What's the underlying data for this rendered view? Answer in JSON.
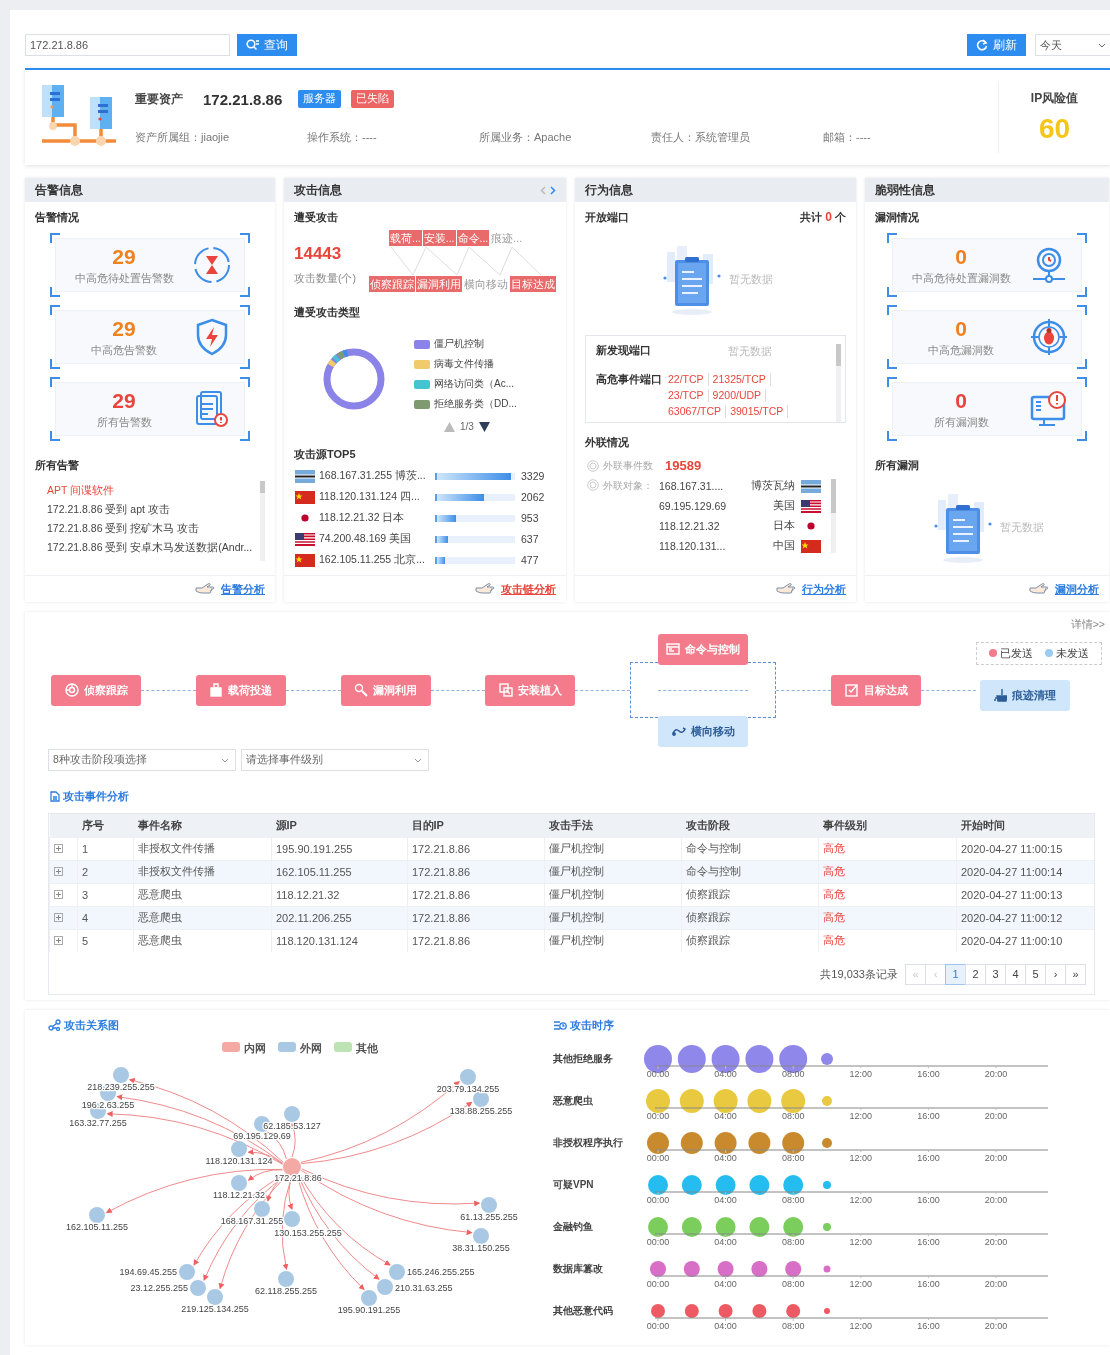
{
  "search": {
    "value": "172.21.8.86",
    "button": "查询"
  },
  "refresh_button": "刷新",
  "range_select": {
    "value": "今天"
  },
  "asset": {
    "title": "重要资产",
    "ip": "172.21.8.86",
    "tags": [
      {
        "label": "服务器",
        "kind": "type"
      },
      {
        "label": "已失陷",
        "kind": "status"
      }
    ],
    "fields": [
      {
        "label": "资产所属组：",
        "value": "jiaojie"
      },
      {
        "label": "操作系统：",
        "value": "----"
      },
      {
        "label": "所属业务：",
        "value": "Apache"
      },
      {
        "label": "责任人：",
        "value": "系统管理员"
      },
      {
        "label": "邮箱：",
        "value": "----"
      }
    ],
    "risk_label": "IP风险值",
    "risk_value": "60"
  },
  "alert_panel": {
    "title": "告警信息",
    "section": "告警情况",
    "stats": [
      {
        "value": "29",
        "label": "中高危待处置告警数",
        "kind": "hourglass",
        "color": "#f0811f"
      },
      {
        "value": "29",
        "label": "中高危告警数",
        "kind": "shield",
        "color": "#f0811f"
      },
      {
        "value": "29",
        "label": "所有告警数",
        "kind": "document",
        "color": "#e8453c"
      }
    ],
    "list_title": "所有告警",
    "alerts": [
      {
        "text": "APT 间谍软件",
        "kind": "heading"
      },
      {
        "text": "172.21.8.86 受到 apt 攻击",
        "kind": "item"
      },
      {
        "text": "172.21.8.86 受到 挖矿木马 攻击",
        "kind": "item"
      },
      {
        "text": "172.21.8.86 受到 安卓木马发送数据(Andr...",
        "kind": "item"
      }
    ],
    "link": "告警分析"
  },
  "attack_panel": {
    "title": "攻击信息",
    "section": "遭受攻击",
    "count": "14443",
    "count_label": "攻击数量(个)",
    "stages_top": [
      {
        "label": "载荷...",
        "highlighted": true
      },
      {
        "label": "安装...",
        "highlighted": true
      },
      {
        "label": "命令...",
        "highlighted": true
      },
      {
        "label": "痕迹...",
        "highlighted": false
      }
    ],
    "stages_bottom": [
      {
        "label": "侦察跟踪",
        "highlighted": true
      },
      {
        "label": "漏洞利用",
        "highlighted": true
      },
      {
        "label": "横向移动",
        "highlighted": false
      },
      {
        "label": "目标达成",
        "highlighted": true
      }
    ],
    "types_title": "遭受攻击类型",
    "types": [
      {
        "label": "僵尸机控制",
        "color": "#8b83e8"
      },
      {
        "label": "病毒文件传播",
        "color": "#efcb6a"
      },
      {
        "label": "网络访问类（Ac...",
        "color": "#45c3d0"
      },
      {
        "label": "拒绝服务类（DD...",
        "color": "#7f9a6e"
      }
    ],
    "types_pager": "1/3",
    "top_title": "攻击源TOP5",
    "top": [
      {
        "label": "168.167.31.255 博茨...",
        "kind": "botswana",
        "level": 0.95,
        "count": "3329"
      },
      {
        "label": "118.120.131.124 四...",
        "kind": "china",
        "level": 0.6,
        "count": "2062"
      },
      {
        "label": "118.12.21.32 日本",
        "kind": "japan",
        "level": 0.24,
        "count": "953"
      },
      {
        "label": "74.200.48.169 美国",
        "kind": "usa",
        "level": 0.14,
        "count": "637"
      },
      {
        "label": "162.105.11.255 北京...",
        "kind": "china",
        "level": 0.1,
        "count": "477"
      }
    ],
    "link": "攻击链分析"
  },
  "behavior_panel": {
    "title": "行为信息",
    "section": "开放端口",
    "total_prefix": "共计",
    "total": "0",
    "total_suffix": "个",
    "empty_text": "暂无数据",
    "new_ports_label": "新发现端口",
    "new_ports_empty": "暂无数据",
    "risk_ports_label": "高危事件端口",
    "risk_ports": [
      "22/TCP",
      "21325/TCP",
      "23/TCP",
      "9200/UDP",
      "63067/TCP",
      "39015/TCP"
    ],
    "outbound_title": "外联情况",
    "event_label": "外联事件数",
    "event_count": "19589",
    "target_label": "外联对象：",
    "targets": [
      {
        "ip": "168.167.31....",
        "country": "博茨瓦纳",
        "kind": "botswana"
      },
      {
        "ip": "69.195.129.69",
        "country": "美国",
        "kind": "usa"
      },
      {
        "ip": "118.12.21.32",
        "country": "日本",
        "kind": "japan"
      },
      {
        "ip": "118.120.131...",
        "country": "中国",
        "kind": "china"
      }
    ],
    "link": "行为分析"
  },
  "vuln_panel": {
    "title": "脆弱性信息",
    "section": "漏洞情况",
    "stats": [
      {
        "value": "0",
        "label": "中高危待处置漏洞数",
        "kind": "pin",
        "color": "#f0811f"
      },
      {
        "value": "0",
        "label": "中高危漏洞数",
        "kind": "bug",
        "color": "#f0811f"
      },
      {
        "value": "0",
        "label": "所有漏洞数",
        "kind": "monitor",
        "color": "#e8453c"
      }
    ],
    "list_title": "所有漏洞",
    "empty_text": "暂无数据",
    "link": "漏洞分析"
  },
  "kill_chain": {
    "details_link": "详情>>",
    "legend": [
      {
        "label": "已发送",
        "color": "#f37b8b"
      },
      {
        "label": "未发送",
        "color": "#9ccbf2"
      }
    ],
    "steps": [
      {
        "label": "侦察跟踪",
        "kind": "target",
        "sent": true
      },
      {
        "label": "载荷投递",
        "kind": "package",
        "sent": true
      },
      {
        "label": "漏洞利用",
        "kind": "magnifier",
        "sent": true
      },
      {
        "label": "安装植入",
        "kind": "install",
        "sent": true
      },
      {
        "label": "命令与控制",
        "kind": "terminal",
        "sent": true
      },
      {
        "label": "横向移动",
        "kind": "lateral",
        "sent": false
      },
      {
        "label": "目标达成",
        "kind": "check",
        "sent": true
      },
      {
        "label": "痕迹清理",
        "kind": "broom",
        "sent": false
      }
    ]
  },
  "filters": [
    {
      "placeholder": "8种攻击阶段项选择"
    },
    {
      "placeholder": "请选择事件级别"
    }
  ],
  "events": {
    "title": "攻击事件分析",
    "columns": [
      "序号",
      "事件名称",
      "源IP",
      "目的IP",
      "攻击手法",
      "攻击阶段",
      "事件级别",
      "开始时间"
    ],
    "rows": [
      {
        "expanded": false,
        "cells": [
          "1",
          "非授权文件传播",
          "195.90.191.255",
          "172.21.8.86",
          "僵尸机控制",
          "命令与控制",
          "高危",
          "2020-04-27 11:00:15"
        ]
      },
      {
        "expanded": false,
        "cells": [
          "2",
          "非授权文件传播",
          "162.105.11.255",
          "172.21.8.86",
          "僵尸机控制",
          "命令与控制",
          "高危",
          "2020-04-27 11:00:14"
        ]
      },
      {
        "expanded": false,
        "cells": [
          "3",
          "恶意爬虫",
          "118.12.21.32",
          "172.21.8.86",
          "僵尸机控制",
          "侦察跟踪",
          "高危",
          "2020-04-27 11:00:13"
        ]
      },
      {
        "expanded": false,
        "cells": [
          "4",
          "恶意爬虫",
          "202.11.206.255",
          "172.21.8.86",
          "僵尸机控制",
          "侦察跟踪",
          "高危",
          "2020-04-27 11:00:12"
        ]
      },
      {
        "expanded": false,
        "cells": [
          "5",
          "恶意爬虫",
          "118.120.131.124",
          "172.21.8.86",
          "僵尸机控制",
          "侦察跟踪",
          "高危",
          "2020-04-27 11:00:10"
        ]
      }
    ],
    "total": "共19,033条记录",
    "first": {
      "label": "«",
      "disabled": true
    },
    "prev": {
      "label": "‹",
      "disabled": true
    },
    "pages": [
      {
        "label": "1",
        "selected": true
      },
      {
        "label": "2",
        "selected": false
      },
      {
        "label": "3",
        "selected": false
      },
      {
        "label": "4",
        "selected": false
      },
      {
        "label": "5",
        "selected": false
      }
    ],
    "next": {
      "label": "›",
      "disabled": false
    },
    "last": {
      "label": "»",
      "disabled": false
    }
  },
  "graph": {
    "title": "攻击关系图",
    "legend": [
      {
        "label": "内网",
        "color": "#f4a9a5"
      },
      {
        "label": "外网",
        "color": "#a9c8e4"
      },
      {
        "label": "其他",
        "color": "#bde3b4"
      }
    ],
    "nodes": [
      {
        "label": "172.21.8.86",
        "kind": "internal"
      },
      {
        "label": "218.239.255.255",
        "kind": "external"
      },
      {
        "label": "196.2.63.255",
        "kind": "external"
      },
      {
        "label": "163.32.77.255",
        "kind": "external"
      },
      {
        "label": "62.185.53.127",
        "kind": "external"
      },
      {
        "label": "69.195.129.69",
        "kind": "external"
      },
      {
        "label": "118.120.131.124",
        "kind": "external"
      },
      {
        "label": "118.12.21.32",
        "kind": "external"
      },
      {
        "label": "168.167.31.255",
        "kind": "external"
      },
      {
        "label": "130.153.255.255",
        "kind": "external"
      },
      {
        "label": "162.105.11.255",
        "kind": "external"
      },
      {
        "label": "203.79.134.255",
        "kind": "external"
      },
      {
        "label": "138.88.255.255",
        "kind": "external"
      },
      {
        "label": "61.13.255.255",
        "kind": "external"
      },
      {
        "label": "38.31.150.255",
        "kind": "external"
      },
      {
        "label": "194.69.45.255",
        "kind": "external"
      },
      {
        "label": "23.12.255.255",
        "kind": "external"
      },
      {
        "label": "219.125.134.255",
        "kind": "external"
      },
      {
        "label": "62.118.255.255",
        "kind": "external"
      },
      {
        "label": "165.246.255.255",
        "kind": "external"
      },
      {
        "label": "210.31.63.255",
        "kind": "external"
      },
      {
        "label": "195.90.191.255",
        "kind": "external"
      }
    ]
  },
  "timeline": {
    "title": "攻击时序",
    "rows": [
      {
        "label": "其他拒绝服务",
        "color": "#8f87ea",
        "ticks": [
          "00:00",
          "04:00",
          "08:00",
          "12:00",
          "16:00",
          "20:00"
        ]
      },
      {
        "label": "恶意爬虫",
        "color": "#e8c940",
        "ticks": [
          "00:00",
          "04:00",
          "08:00",
          "12:00",
          "16:00",
          "20:00"
        ]
      },
      {
        "label": "非授权程序执行",
        "color": "#c98a2e",
        "ticks": [
          "00:00",
          "04:00",
          "08:00",
          "12:00",
          "16:00",
          "20:00"
        ]
      },
      {
        "label": "可疑VPN",
        "color": "#25bdf0",
        "ticks": [
          "00:00",
          "04:00",
          "08:00",
          "12:00",
          "16:00",
          "20:00"
        ]
      },
      {
        "label": "金融钓鱼",
        "color": "#7bcd5c",
        "ticks": [
          "00:00",
          "04:00",
          "08:00",
          "12:00",
          "16:00",
          "20:00"
        ]
      },
      {
        "label": "数据库篡改",
        "color": "#d86fc6",
        "ticks": [
          "00:00",
          "04:00",
          "08:00",
          "12:00",
          "16:00",
          "20:00"
        ]
      },
      {
        "label": "其他恶意代码",
        "color": "#ee5a64",
        "ticks": [
          "00:00",
          "04:00",
          "08:00",
          "12:00",
          "16:00",
          "20:00"
        ]
      }
    ]
  }
}
